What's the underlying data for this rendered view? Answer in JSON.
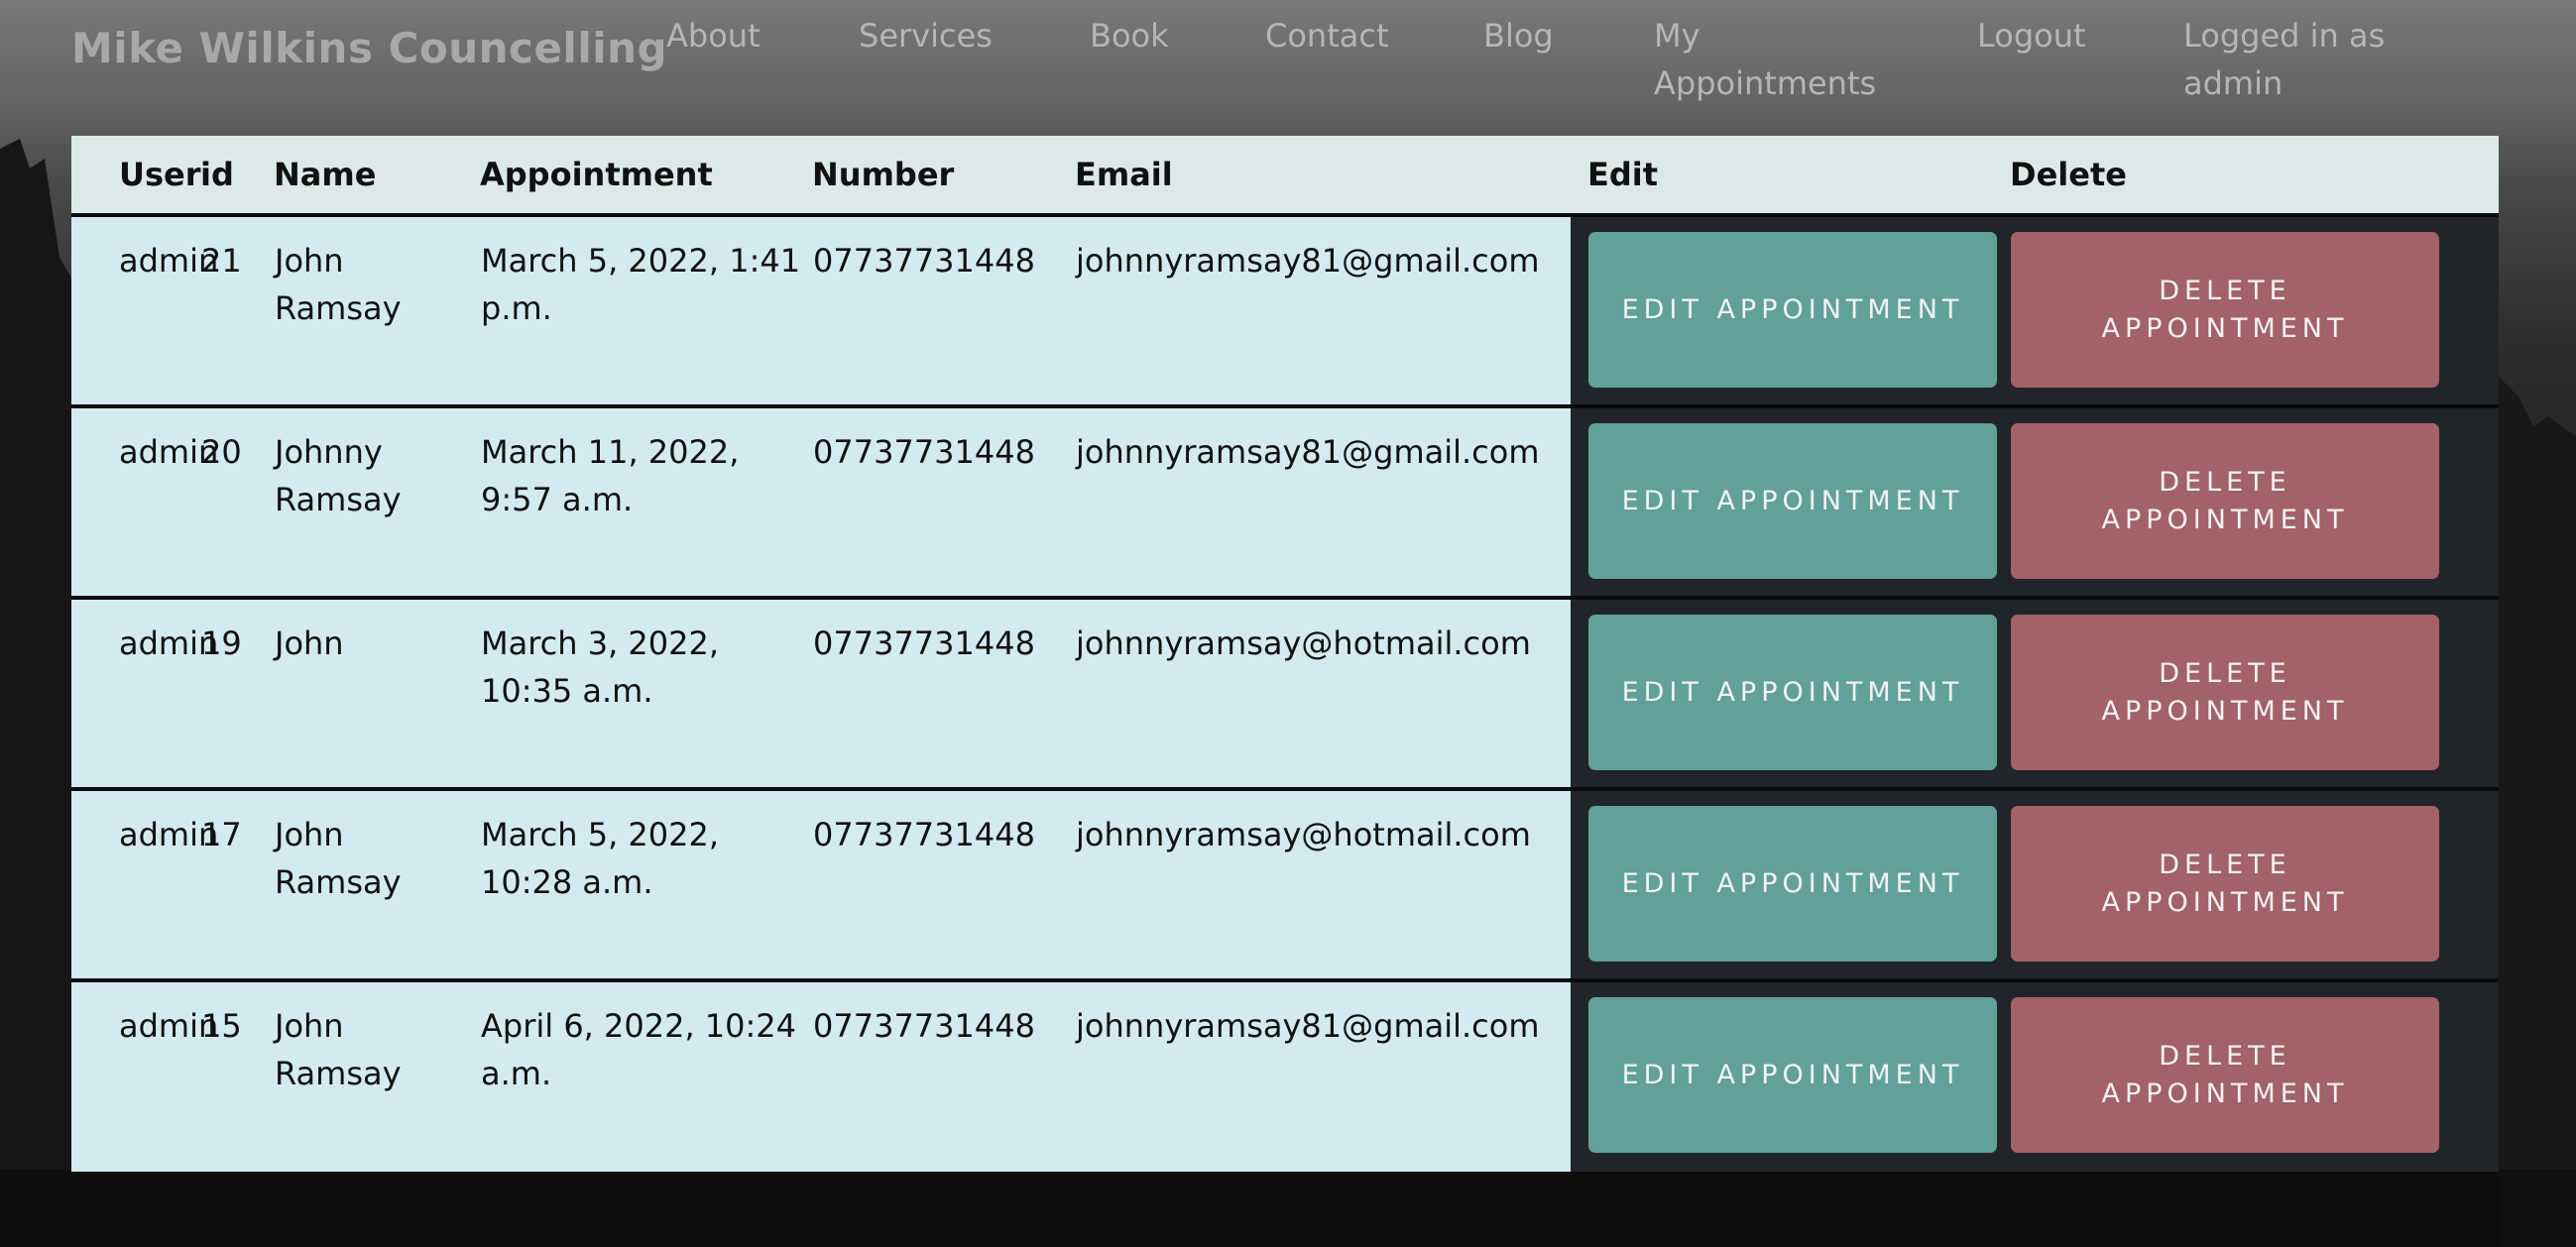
{
  "navbar": {
    "brand": "Mike Wilkins Councelling",
    "items": [
      {
        "label": "About"
      },
      {
        "label": "Services"
      },
      {
        "label": "Book"
      },
      {
        "label": "Contact"
      },
      {
        "label": "Blog"
      },
      {
        "label": "My Appointments"
      },
      {
        "label": "Logout"
      }
    ],
    "status": "Logged in as admin"
  },
  "table": {
    "headers": [
      "User",
      "id",
      "Name",
      "Appointment",
      "Number",
      "Email",
      "Edit",
      "Delete"
    ],
    "edit_label": "Edit Appointment",
    "delete_label": "Delete Appointment",
    "rows": [
      {
        "user": "admin",
        "id": "21",
        "name": "John Ramsay",
        "appointment": "March 5, 2022, 1:41 p.m.",
        "number": "07737731448",
        "email": "johnnyramsay81@gmail.com"
      },
      {
        "user": "admin",
        "id": "20",
        "name": "Johnny Ramsay",
        "appointment": "March 11, 2022, 9:57 a.m.",
        "number": "07737731448",
        "email": "johnnyramsay81@gmail.com"
      },
      {
        "user": "admin",
        "id": "19",
        "name": "John",
        "appointment": "March 3, 2022, 10:35 a.m.",
        "number": "07737731448",
        "email": "johnnyramsay@hotmail.com"
      },
      {
        "user": "admin",
        "id": "17",
        "name": "John Ramsay",
        "appointment": "March 5, 2022, 10:28 a.m.",
        "number": "07737731448",
        "email": "johnnyramsay@hotmail.com"
      },
      {
        "user": "admin",
        "id": "15",
        "name": "John Ramsay",
        "appointment": "April 6, 2022, 10:24 a.m.",
        "number": "07737731448",
        "email": "johnnyramsay81@gmail.com"
      }
    ]
  },
  "colors": {
    "edit_button": "#62a09c",
    "delete_button": "#a26267",
    "row_light": "#d3ebf0",
    "row_dark": "#212529",
    "header_bg": "#dce9e8"
  }
}
